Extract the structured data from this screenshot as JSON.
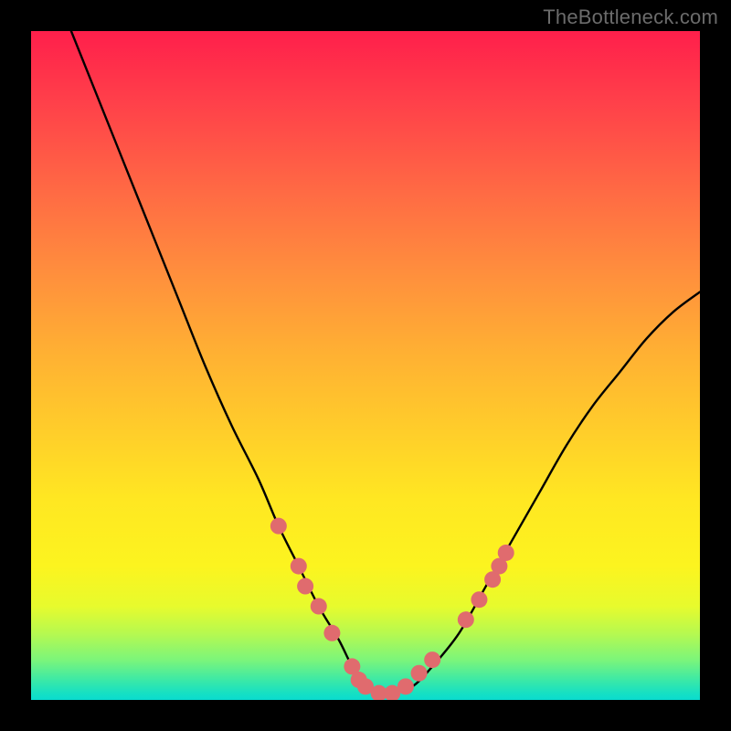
{
  "watermark": "TheBottleneck.com",
  "chart_data": {
    "type": "line",
    "title": "",
    "xlabel": "",
    "ylabel": "",
    "xlim": [
      0,
      100
    ],
    "ylim": [
      0,
      100
    ],
    "series": [
      {
        "name": "bottleneck-curve",
        "x": [
          6,
          10,
          14,
          18,
          22,
          26,
          30,
          34,
          37,
          40,
          43,
          46,
          48,
          50,
          52,
          54,
          57,
          60,
          64,
          68,
          72,
          76,
          80,
          84,
          88,
          92,
          96,
          100
        ],
        "values": [
          100,
          90,
          80,
          70,
          60,
          50,
          41,
          33,
          26,
          20,
          14,
          9,
          5,
          2,
          1,
          1,
          2,
          5,
          10,
          17,
          24,
          31,
          38,
          44,
          49,
          54,
          58,
          61
        ]
      }
    ],
    "markers": {
      "name": "highlight-points",
      "color": "#e06b6e",
      "points": [
        {
          "x": 37,
          "y": 26
        },
        {
          "x": 40,
          "y": 20
        },
        {
          "x": 41,
          "y": 17
        },
        {
          "x": 43,
          "y": 14
        },
        {
          "x": 45,
          "y": 10
        },
        {
          "x": 48,
          "y": 5
        },
        {
          "x": 49,
          "y": 3
        },
        {
          "x": 50,
          "y": 2
        },
        {
          "x": 52,
          "y": 1
        },
        {
          "x": 54,
          "y": 1
        },
        {
          "x": 56,
          "y": 2
        },
        {
          "x": 58,
          "y": 4
        },
        {
          "x": 60,
          "y": 6
        },
        {
          "x": 65,
          "y": 12
        },
        {
          "x": 67,
          "y": 15
        },
        {
          "x": 69,
          "y": 18
        },
        {
          "x": 70,
          "y": 20
        },
        {
          "x": 71,
          "y": 22
        }
      ]
    },
    "gradient_stops": [
      {
        "pos": 0,
        "color": "#ff1f4b"
      },
      {
        "pos": 50,
        "color": "#ffc22e"
      },
      {
        "pos": 85,
        "color": "#f4f724"
      },
      {
        "pos": 100,
        "color": "#0adccf"
      }
    ]
  }
}
